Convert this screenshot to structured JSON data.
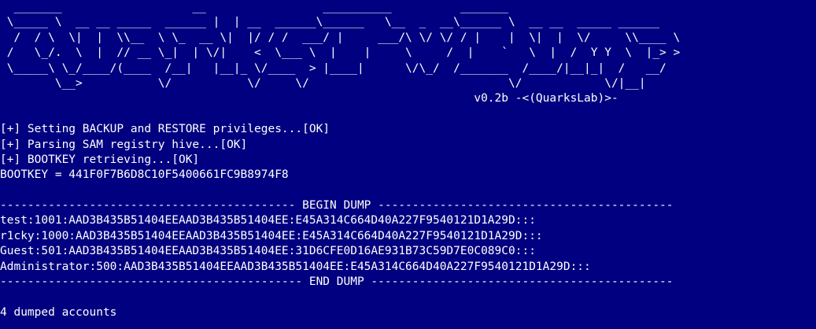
{
  "console": {
    "background_color": "#000080",
    "text_color": "#ffffff",
    "banner_lines": [
      "  _______                   __                 __________          _______",
      " \\_____ \\  __ __ _____  ______ |  | __  ______\\______   \\__  _  __\\______ \\  __ __  _____ ______",
      "  /  / \\  \\|  |  \\\\__  \\ \\_  __ \\|  |/ / /  ___/ |     ___/\\ \\/ \\/ / |    |  \\|  |  \\/     \\\\____ \\",
      " /   \\_/.  \\  |  // __ \\_|  | \\/|    <  \\___ \\  |    |     \\     /  |    `   \\  |  /  Y Y  \\  |_> >",
      " \\_____\\ \\_/____/(____  /__|   |__|_ \\/____  > |____|      \\/\\_/  /_______  /____/|__|_|  /   __/",
      "        \\__>           \\/           \\/     \\/                             \\/            \\/|__|"
    ],
    "version_line": "                                                                     v0.2b -<(QuarksLab)>-",
    "blank": "",
    "status_lines": [
      "[+] Setting BACKUP and RESTORE privileges...[OK]",
      "[+] Parsing SAM registry hive...[OK]",
      "[+] BOOTKEY retrieving...[OK]",
      "BOOTKEY = 441F0F7B6D8C10F5400661FC9B8974F8"
    ],
    "begin_dump": "------------------------------------------- BEGIN DUMP -------------------------------------------",
    "dump_lines": [
      "test:1001:AAD3B435B51404EEAAD3B435B51404EE:E45A314C664D40A227F9540121D1A29D:::",
      "r1cky:1000:AAD3B435B51404EEAAD3B435B51404EE:E45A314C664D40A227F9540121D1A29D:::",
      "Guest:501:AAD3B435B51404EEAAD3B435B51404EE:31D6CFE0D16AE931B73C59D7E0C089C0:::",
      "Administrator:500:AAD3B435B51404EEAAD3B435B51404EE:E45A314C664D40A227F9540121D1A29D:::"
    ],
    "end_dump": "-------------------------------------------- END DUMP --------------------------------------------",
    "summary": "4 dumped accounts"
  }
}
